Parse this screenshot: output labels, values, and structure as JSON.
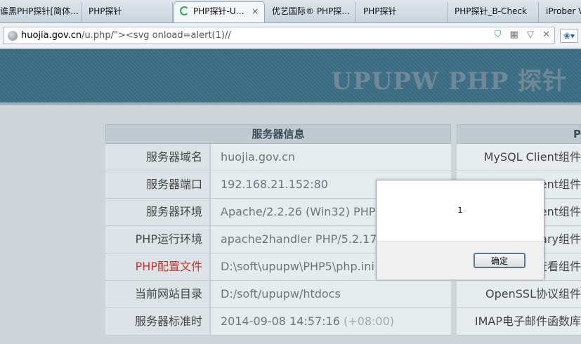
{
  "tabs": [
    {
      "label": "谁黑PHP探针[简体…",
      "active": false
    },
    {
      "label": "PHP探针",
      "active": false
    },
    {
      "label": "PHP探针-U…",
      "active": true
    },
    {
      "label": "优艺国际® PHP探…",
      "active": false
    },
    {
      "label": "PHP探针",
      "active": false
    },
    {
      "label": "PHP探针_B-Check",
      "active": false
    },
    {
      "label": "iProber V",
      "active": false
    }
  ],
  "address": {
    "host": "huojia.gov.cn",
    "path": "/u.php/\"><svg onload=alert(1)//"
  },
  "icons": {
    "tab_close": "×",
    "security": "shield-icon",
    "qr": "qr-icon",
    "dropdown": "chevron-down-icon",
    "stop": "close-icon"
  },
  "page": {
    "banner_title": "UPUPW PHP 探针",
    "server_info": {
      "header": "服务器信息",
      "rows": [
        {
          "key": "服务器域名",
          "value": "huojia.gov.cn",
          "highlight": false
        },
        {
          "key": "服务器端口",
          "value": "192.168.21.152:80",
          "highlight": false
        },
        {
          "key": "服务器环境",
          "value": "Apache/2.2.26 (Win32) PHP/5.2.17",
          "highlight": false
        },
        {
          "key": "PHP运行环境",
          "value": "apache2handler PHP/5.2.17",
          "highlight": false
        },
        {
          "key": "PHP配置文件",
          "value": "D:\\soft\\upupw\\PHP5\\php.ini",
          "highlight": true
        },
        {
          "key": "当前网站目录",
          "value": "D:/soft/upupw/htdocs",
          "highlight": false
        },
        {
          "key": "服务器标准时",
          "value": "2014-09-08 14:57:16",
          "tz": "(+08:00)",
          "highlight": false
        }
      ]
    },
    "php_components": {
      "header": "P",
      "rows": [
        "MySQL Client组件",
        "lient组件",
        "lient组件",
        "rary组件",
        "查看组件",
        "OpenSSL协议组件",
        "IMAP电子邮件函数库"
      ]
    }
  },
  "alert": {
    "message": "1",
    "ok_label": "确定"
  }
}
